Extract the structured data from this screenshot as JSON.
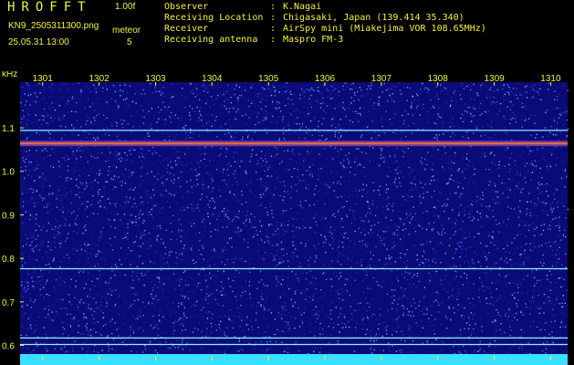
{
  "header": {
    "app_title": "HROFFT",
    "version": "1.00f",
    "file_name": "KN9_2505311300.png",
    "meteor_label": "meteor",
    "meteor_count": "5",
    "datetime": "25.05.31 13:00",
    "meta": [
      {
        "key": "Observer",
        "value": "K.Nagai"
      },
      {
        "key": "Receiving Location",
        "value": "Chigasaki, Japan (139.414 35.340)"
      },
      {
        "key": "Receiver",
        "value": "AirSpy mini (Miakejima VOR 108.65MHz)"
      },
      {
        "key": "Receiving antenna",
        "value": "Maspro FM-3"
      }
    ]
  },
  "colors": {
    "text": "#f2f23a",
    "background": "#000000",
    "noise_base": "#0b0b78",
    "carrier": "#e66a48",
    "line": "#8ef0ff"
  },
  "chart_data": {
    "type": "heatmap",
    "y_unit": "kHz",
    "y_ticks": [
      "1.1",
      "1.0",
      "0.9",
      "0.8",
      "0.7",
      "0.6"
    ],
    "y_tick_values": [
      1.1,
      1.0,
      0.9,
      0.8,
      0.7,
      0.6
    ],
    "x_ticks": [
      "1301",
      "1302",
      "1303",
      "1304",
      "1305",
      "1306",
      "1307",
      "1308",
      "1309",
      "1310"
    ],
    "x_tick_values": [
      1301,
      1302,
      1303,
      1304,
      1305,
      1306,
      1307,
      1308,
      1309,
      1310
    ],
    "ylim": [
      0.58,
      1.205
    ],
    "xlim": [
      1300.6,
      1310.3
    ],
    "horizontal_lines_khz": [
      1.094,
      1.064,
      0.776,
      0.617,
      0.602
    ],
    "strong_carrier_khz": 1.064
  }
}
